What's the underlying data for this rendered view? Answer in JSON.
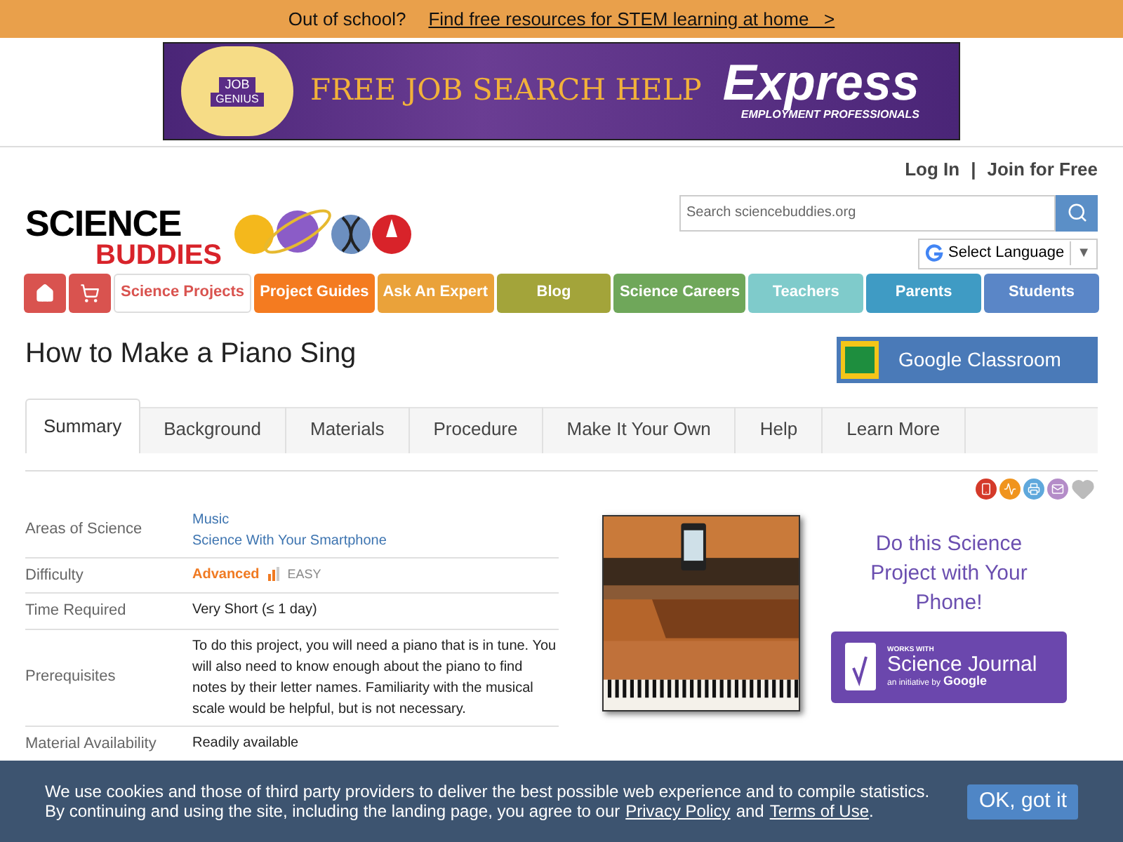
{
  "promo_bar": {
    "text": "Out of school?",
    "link": "Find free resources for STEM learning at home   >"
  },
  "ad": {
    "badge_top": "JOB",
    "badge_bottom": "GENIUS",
    "headline": "FREE JOB SEARCH HELP",
    "brand": "Express",
    "brand_sub": "EMPLOYMENT PROFESSIONALS"
  },
  "header": {
    "login": "Log In",
    "separator": "|",
    "join": "Join for Free",
    "logo_top": "SCIENCE",
    "logo_bottom": "BUDDIES",
    "search": {
      "placeholder": "Search sciencebuddies.org"
    },
    "language": "Select Language",
    "language_caret": "▼"
  },
  "nav": [
    {
      "kind": "home",
      "selected": false,
      "color": "#d9534f"
    },
    {
      "kind": "cart",
      "selected": false,
      "color": "#d9534f"
    },
    {
      "kind": "text",
      "label": "Science Projects",
      "selected": true,
      "color": "#d9534f"
    },
    {
      "kind": "text",
      "label": "Project Guides",
      "selected": false,
      "color": "#f47b20"
    },
    {
      "kind": "text",
      "label": "Ask An Expert",
      "selected": false,
      "color": "#eaa23a"
    },
    {
      "kind": "text",
      "label": "Blog",
      "selected": false,
      "color": "#a3a43a"
    },
    {
      "kind": "text",
      "label": "Science Careers",
      "selected": false,
      "color": "#6fa75a"
    },
    {
      "kind": "text",
      "label": "Teachers",
      "selected": false,
      "color": "#7fcbcb"
    },
    {
      "kind": "text",
      "label": "Parents",
      "selected": false,
      "color": "#3f9bc4"
    },
    {
      "kind": "text",
      "label": "Students",
      "selected": false,
      "color": "#5a86c7"
    }
  ],
  "page_title": "How to Make a Piano Sing",
  "classroom_button": "Google Classroom",
  "tabs": [
    {
      "label": "Summary",
      "selected": true
    },
    {
      "label": "Background",
      "selected": false
    },
    {
      "label": "Materials",
      "selected": false
    },
    {
      "label": "Procedure",
      "selected": false
    },
    {
      "label": "Make It Your Own",
      "selected": false
    },
    {
      "label": "Help",
      "selected": false
    },
    {
      "label": "Learn More",
      "selected": false
    }
  ],
  "share_icons": [
    {
      "kind": "phone",
      "color": "#d43a2a"
    },
    {
      "kind": "wave",
      "color": "#f0941e"
    },
    {
      "kind": "print",
      "color": "#5fa8dc"
    },
    {
      "kind": "mail",
      "color": "#b48cc8"
    },
    {
      "kind": "heart",
      "color": "#bbbbbb"
    }
  ],
  "summary": [
    {
      "kind": "links",
      "label": "Areas of Science",
      "values": [
        "Music",
        "Science With Your Smartphone"
      ]
    },
    {
      "kind": "difficulty",
      "label": "Difficulty",
      "value": "Advanced",
      "note": "EASY"
    },
    {
      "kind": "text",
      "label": "Time Required",
      "value": "Very Short (≤ 1 day)"
    },
    {
      "kind": "text",
      "label": "Prerequisites",
      "value": "To do this project, you will need a piano that is in tune. You will also need to know enough about the piano to find notes by their letter names. Familiarity with the musical scale would be helpful, but is not necessary."
    },
    {
      "kind": "text",
      "label": "Material Availability",
      "value": "Readily available"
    }
  ],
  "phone_promo": {
    "text": "Do this Science Project with Your Phone!",
    "badge_top": "WORKS WITH",
    "badge_title": "Science Journal",
    "badge_sub": "an initiative by",
    "badge_brand": "Google"
  },
  "cookie_banner": {
    "line1": "We use cookies and those of third party providers to deliver the best possible web experience and to compile statistics.",
    "line2_before": "By continuing and using the site, including the landing page, you agree to our",
    "privacy_link": "Privacy Policy",
    "and": "and",
    "terms_link": "Terms of Use",
    "end": ".",
    "button": "OK, got it"
  }
}
